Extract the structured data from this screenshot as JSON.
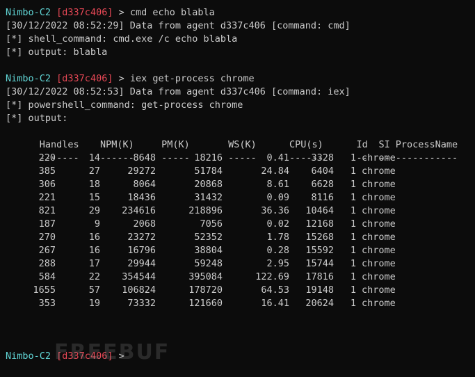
{
  "colors": {
    "background": "#0c0c0c",
    "foreground": "#cccccc",
    "prompt_name": "#61d6d6",
    "prompt_agent": "#e74856"
  },
  "prompt": {
    "name": "Nimbo-C2",
    "agent": "[d337c406]",
    "arrow": " > "
  },
  "block1": {
    "command": "cmd echo blabla",
    "log": "[30/12/2022 08:52:29] Data from agent d337c406 [command: cmd]",
    "shell_command": "[*] shell_command: cmd.exe /c echo blabla",
    "output": "[*] output: blabla"
  },
  "block2": {
    "command": "iex get-process chrome",
    "log": "[30/12/2022 08:52:53] Data from agent d337c406 [command: iex]",
    "powershell_command": "[*] powershell_command: get-process chrome",
    "output_label": "[*] output:"
  },
  "table": {
    "headers": [
      "Handles",
      "NPM(K)",
      "PM(K)",
      "WS(K)",
      "CPU(s)",
      "Id",
      "SI",
      "ProcessName"
    ],
    "separators": [
      "-------",
      "------",
      "-----",
      "-----",
      "------",
      "--",
      "--",
      "-----------"
    ],
    "rows": [
      [
        "220",
        "14",
        "8648",
        "18216",
        "0.41",
        "3328",
        "1",
        "chrome"
      ],
      [
        "385",
        "27",
        "29272",
        "51784",
        "24.84",
        "6404",
        "1",
        "chrome"
      ],
      [
        "306",
        "18",
        "8064",
        "20868",
        "8.61",
        "6628",
        "1",
        "chrome"
      ],
      [
        "221",
        "15",
        "18436",
        "31432",
        "0.09",
        "8116",
        "1",
        "chrome"
      ],
      [
        "821",
        "29",
        "234616",
        "218896",
        "36.36",
        "10464",
        "1",
        "chrome"
      ],
      [
        "187",
        "9",
        "2068",
        "7056",
        "0.02",
        "12168",
        "1",
        "chrome"
      ],
      [
        "270",
        "16",
        "23272",
        "52352",
        "1.78",
        "15268",
        "1",
        "chrome"
      ],
      [
        "267",
        "16",
        "16796",
        "38804",
        "0.28",
        "15592",
        "1",
        "chrome"
      ],
      [
        "288",
        "17",
        "29944",
        "59248",
        "2.95",
        "15744",
        "1",
        "chrome"
      ],
      [
        "584",
        "22",
        "354544",
        "395084",
        "122.69",
        "17816",
        "1",
        "chrome"
      ],
      [
        "1655",
        "57",
        "106824",
        "178720",
        "64.53",
        "19148",
        "1",
        "chrome"
      ],
      [
        "353",
        "19",
        "73332",
        "121660",
        "16.41",
        "20624",
        "1",
        "chrome"
      ]
    ]
  },
  "watermark": "FREEBUF"
}
